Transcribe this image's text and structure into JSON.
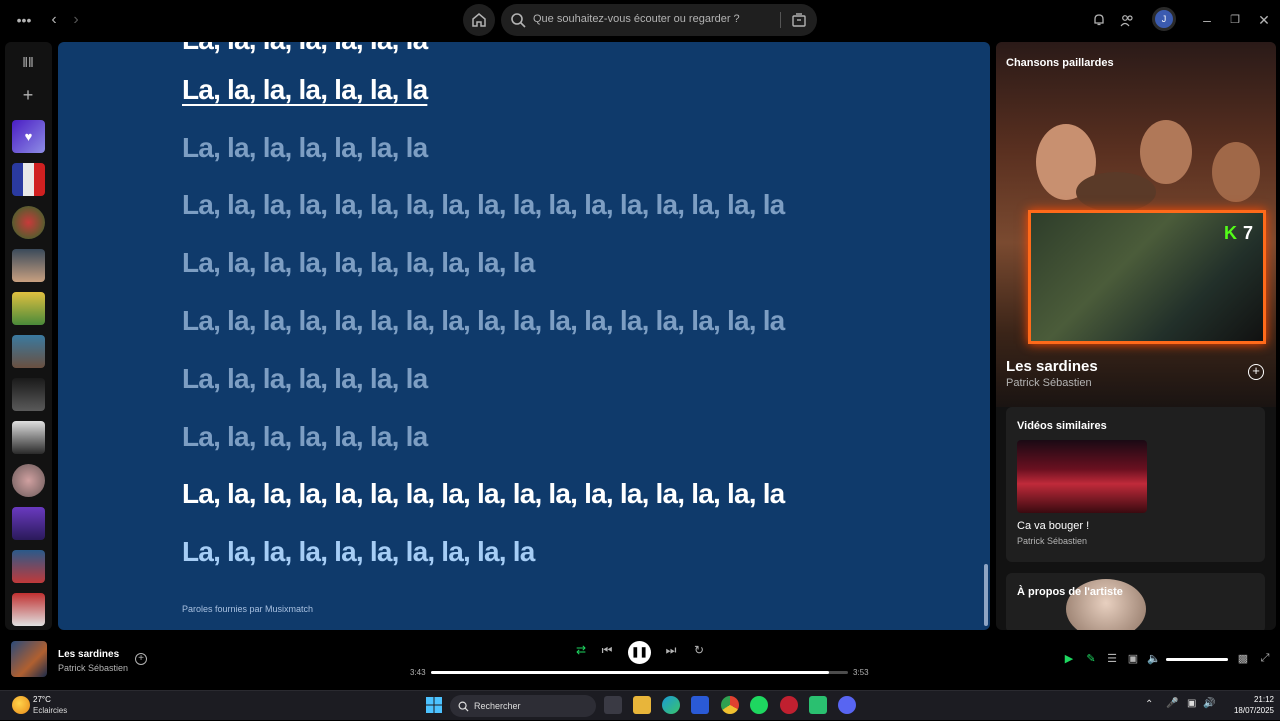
{
  "topbar": {
    "search_placeholder": "Que souhaitez-vous écouter ou regarder ?",
    "avatar_initial": "J",
    "icons": [
      "more-icon",
      "back-arrow-icon",
      "forward-arrow-icon",
      "home-icon",
      "search-icon",
      "browse-icon",
      "bell-icon",
      "friends-icon",
      "minimize-icon",
      "restore-icon",
      "close-icon"
    ]
  },
  "lyrics": {
    "lines": [
      "La, la, la, la, la, la, la",
      "La, la, la, la, la, la, la",
      "La, la, la, la, la, la, la, la, la, la, la, la, la, la, la, la, la",
      "La, la, la, la, la, la, la, la, la, la",
      "La, la, la, la, la, la, la, la, la, la, la, la, la, la, la, la, la",
      "La, la, la, la, la, la, la",
      "La, la, la, la, la, la, la",
      "La, la, la, la, la, la, la, la, la, la, la, la, la, la, la, la, la",
      "La, la, la, la, la, la, la, la, la, la"
    ],
    "credits": "Paroles fournies par Musixmatch",
    "background": "#0f3a6b"
  },
  "right_panel": {
    "playlist_title": "Chansons paillardes",
    "kick_count": "7",
    "song_title": "Les sardines",
    "song_artist": "Patrick Sébastien",
    "similar_videos_heading": "Vidéos similaires",
    "similar_video_title": "Ca va bouger !",
    "similar_video_artist": "Patrick Sébastien",
    "about_artist_heading": "À propos de l'artiste"
  },
  "player": {
    "track_title": "Les sardines",
    "track_artist": "Patrick Sébastien",
    "elapsed": "3:43",
    "duration": "3:53",
    "progress": 0.955,
    "volume": 1.0,
    "accent": "#1ed760"
  },
  "taskbar": {
    "temperature": "27°C",
    "weather": "Eclaircies",
    "search_label": "Rechercher",
    "time": "21:12",
    "date": "18/07/2025"
  }
}
